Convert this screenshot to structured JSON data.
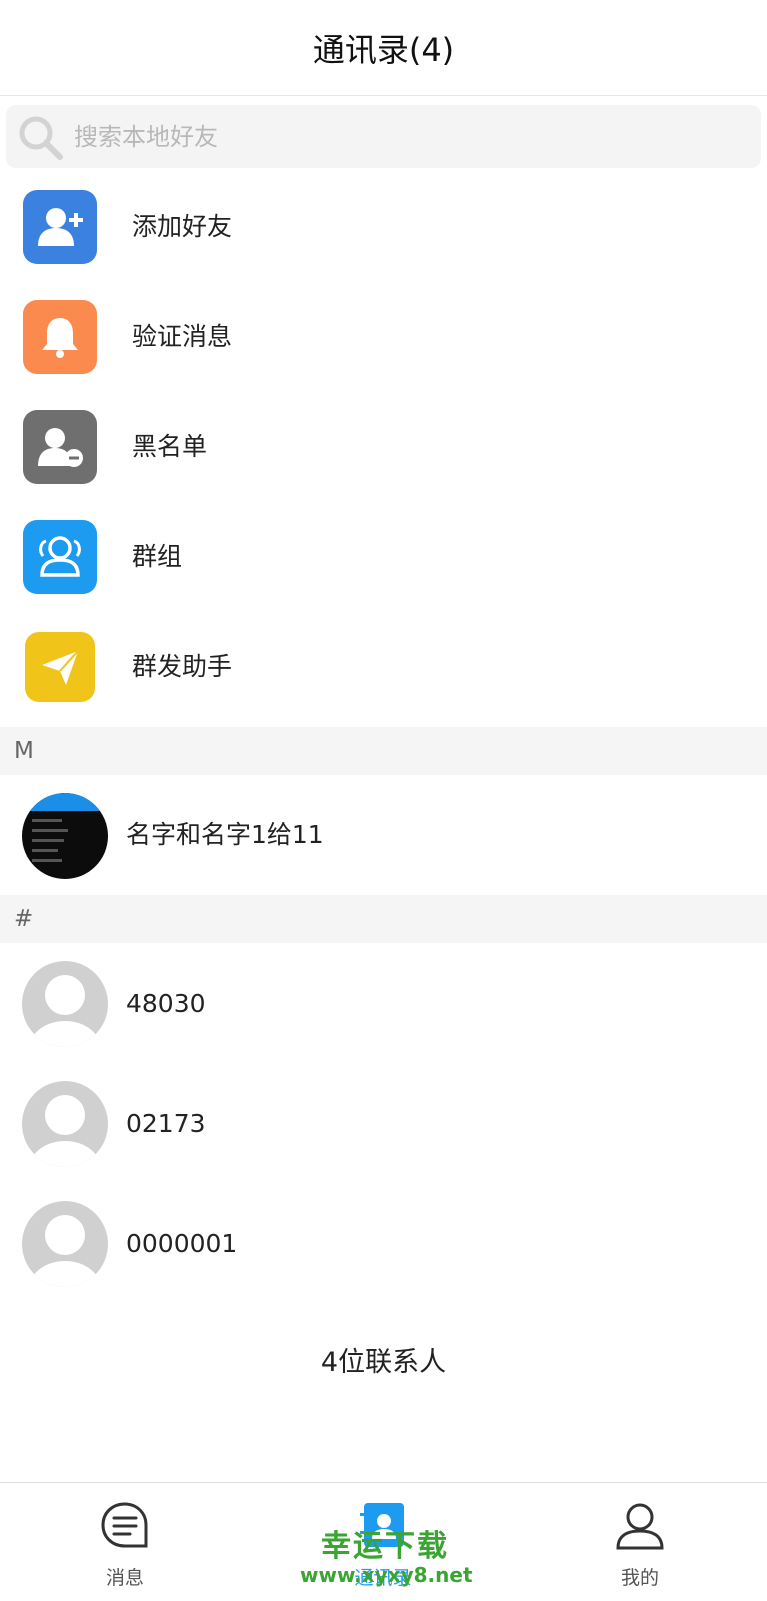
{
  "header": {
    "title": "通讯录(4)"
  },
  "search": {
    "placeholder": "搜索本地好友",
    "icon": "search-icon"
  },
  "menu": [
    {
      "label": "添加好友",
      "icon": "add-user-icon",
      "color": "#3b82e0"
    },
    {
      "label": "验证消息",
      "icon": "bell-icon",
      "color": "#fb8a4e"
    },
    {
      "label": "黑名单",
      "icon": "blocked-user-icon",
      "color": "#6f6f6f"
    },
    {
      "label": "群组",
      "icon": "group-icon",
      "color": "#1d9bf0"
    },
    {
      "label": "群发助手",
      "icon": "paper-plane-icon",
      "color": "#f0c419"
    }
  ],
  "sections": [
    {
      "letter": "M",
      "contacts": [
        {
          "name": "名字和名字1给11",
          "avatar": "custom-photo-avatar"
        }
      ]
    },
    {
      "letter": "#",
      "contacts": [
        {
          "name": "48030",
          "avatar": "default-avatar"
        },
        {
          "name": "02173",
          "avatar": "default-avatar"
        },
        {
          "name": "0000001",
          "avatar": "default-avatar"
        }
      ]
    }
  ],
  "footer": {
    "count_text": "4位联系人"
  },
  "tabbar": {
    "tabs": [
      {
        "label": "消息",
        "icon": "message-icon"
      },
      {
        "label": "通讯录",
        "icon": "contacts-icon",
        "active": true
      },
      {
        "label": "我的",
        "icon": "profile-icon"
      }
    ]
  },
  "watermark": {
    "line1": "幸运下载",
    "line2": "www.xyxy8.net"
  },
  "colors": {
    "accent": "#1d9bf0",
    "watermark": "#3aa531"
  }
}
